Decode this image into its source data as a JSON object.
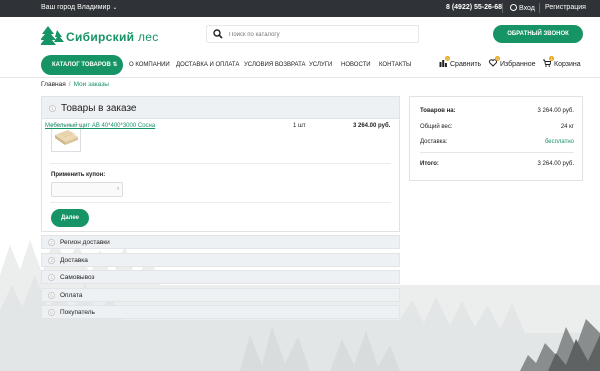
{
  "topbar": {
    "city": "Ваш город Владимир",
    "phone": "8 (4922) 55-26-68",
    "login": "Вход",
    "register": "Регистрация"
  },
  "header": {
    "logo_main": "Сибирский",
    "logo_accent": "лес",
    "search_placeholder": "Поиск по каталогу",
    "callback": "ОБРАТНЫЙ ЗВОНОК"
  },
  "nav": {
    "catalog": "КАТАЛОГ ТОВАРОВ",
    "items": [
      {
        "label": "О КОМПАНИИ"
      },
      {
        "label": "ДОСТАВКА И ОПЛАТА"
      },
      {
        "label": "УСЛОВИЯ ВОЗВРАТА"
      },
      {
        "label": "УСЛУГИ"
      },
      {
        "label": "НОВОСТИ"
      },
      {
        "label": "КОНТАКТЫ"
      }
    ],
    "compare": {
      "label": "Сравнить",
      "count": "0"
    },
    "favorites": {
      "label": "Избранное",
      "count": "0"
    },
    "cart": {
      "label": "Корзина",
      "count": "1"
    }
  },
  "breadcrumb": {
    "home": "Главная",
    "current": "Мои заказы"
  },
  "order": {
    "step_number": "1",
    "title": "Товары в заказе",
    "product": {
      "name": "Мебельный щит АВ 40*400*3000 Сосна",
      "qty": "1 шт",
      "price": "3 264.00 руб."
    },
    "coupon_label": "Применить купон:",
    "coupon_arrow": "›",
    "next": "Далее"
  },
  "steps": [
    {
      "num": "2",
      "label": "Регион доставки"
    },
    {
      "num": "3",
      "label": "Доставка"
    },
    {
      "num": "4",
      "label": "Самовывоз"
    },
    {
      "num": "5",
      "label": "Оплата"
    },
    {
      "num": "6",
      "label": "Покупатель"
    }
  ],
  "summary": {
    "goods_label": "Товаров на:",
    "goods_value": "3 264.00 руб.",
    "weight_label": "Общий вес:",
    "weight_value": "24 кг",
    "delivery_label": "Доставка:",
    "delivery_value": "бесплатно",
    "total_label": "Итого:",
    "total_value": "3 264.00 руб."
  },
  "colors": {
    "brand": "#169465",
    "topbar": "#2f3236",
    "badge": "#e8a620"
  }
}
